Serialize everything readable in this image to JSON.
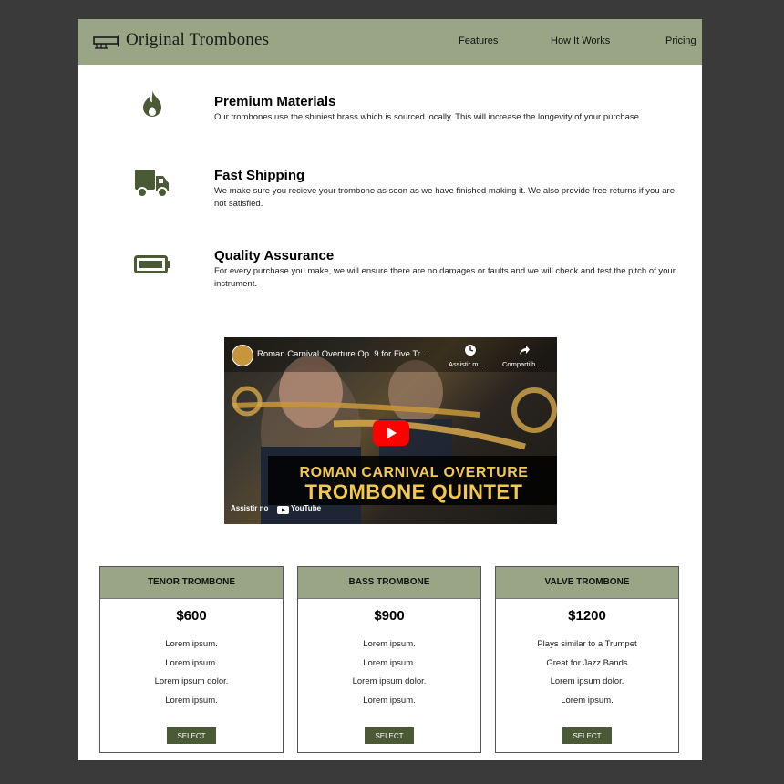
{
  "header": {
    "brand": "Original Trombones",
    "logo_icon": "trombone-logo-icon",
    "nav": [
      "Features",
      "How It Works",
      "Pricing"
    ]
  },
  "features": [
    {
      "icon": "flame-icon",
      "title": "Premium Materials",
      "desc": "Our trombones use the shiniest brass which is sourced locally. This will increase the longevity of your purchase."
    },
    {
      "icon": "truck-icon",
      "title": "Fast Shipping",
      "desc": "We make sure you recieve your trombone as soon as we have finished making it. We also provide free returns if you are not satisfied."
    },
    {
      "icon": "battery-icon",
      "title": "Quality Assurance",
      "desc": "For every purchase you make, we will ensure there are no damages or faults and we will check and test the pitch of your instrument."
    }
  ],
  "video": {
    "title": "Roman Carnival Overture Op. 9 for Five Tr...",
    "watch_later": "Assistir m...",
    "share": "Compartilh...",
    "banner_line1": "ROMAN CARNIVAL OVERTURE",
    "banner_line2": "TROMBONE QUINTET",
    "watch_on": "Assistir no",
    "youtube": "YouTube"
  },
  "pricing": [
    {
      "name": "TENOR TROMBONE",
      "price": "$600",
      "features": [
        "Lorem ipsum.",
        "Lorem ipsum.",
        "Lorem ipsum dolor.",
        "Lorem ipsum."
      ],
      "button": "SELECT"
    },
    {
      "name": "BASS TROMBONE",
      "price": "$900",
      "features": [
        "Lorem ipsum.",
        "Lorem ipsum.",
        "Lorem ipsum dolor.",
        "Lorem ipsum."
      ],
      "button": "SELECT"
    },
    {
      "name": "VALVE TROMBONE",
      "price": "$1200",
      "features": [
        "Plays similar to a Trumpet",
        "Great for Jazz Bands",
        "Lorem ipsum dolor.",
        "Lorem ipsum."
      ],
      "button": "SELECT"
    }
  ],
  "colors": {
    "header_bg": "#99a585",
    "icon": "#4a5a34",
    "button_bg": "#4a5a34",
    "page_bg": "#ffffff",
    "backdrop": "#3a3a3a"
  }
}
